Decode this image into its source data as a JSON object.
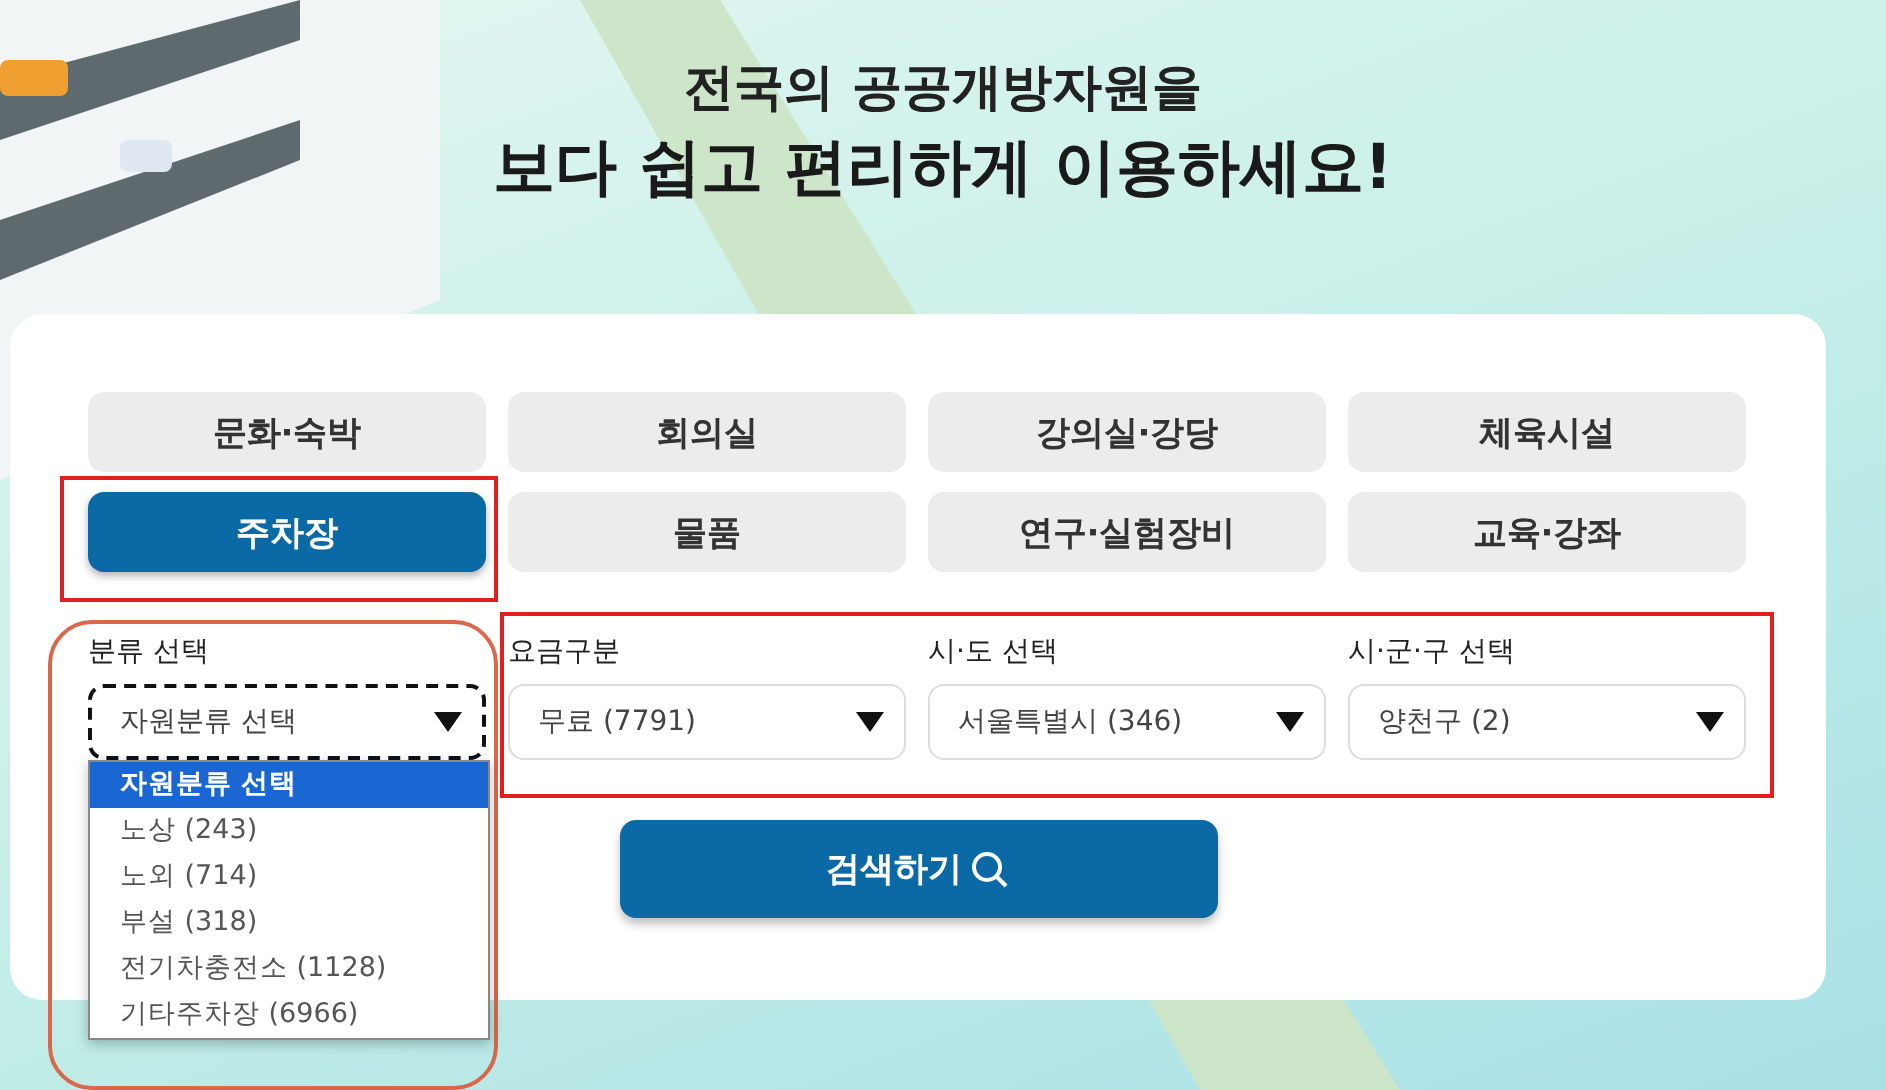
{
  "headline": {
    "line_1": "전국의 공공개방자원을",
    "line_2": "보다 쉽고 편리하게 이용하세요!"
  },
  "tabs": [
    {
      "label": "문화·숙박",
      "selected": false
    },
    {
      "label": "회의실",
      "selected": false
    },
    {
      "label": "강의실·강당",
      "selected": false
    },
    {
      "label": "체육시설",
      "selected": false
    },
    {
      "label": "주차장",
      "selected": true
    },
    {
      "label": "물품",
      "selected": false
    },
    {
      "label": "연구·실험장비",
      "selected": false
    },
    {
      "label": "교육·강좌",
      "selected": false
    }
  ],
  "filters": [
    {
      "label": "분류 선택",
      "value": "자원분류 선택",
      "expanded": true,
      "options": [
        {
          "label": "자원분류 선택",
          "selected": true
        },
        {
          "label": "노상 (243)",
          "selected": false
        },
        {
          "label": "노외 (714)",
          "selected": false
        },
        {
          "label": "부설 (318)",
          "selected": false
        },
        {
          "label": "전기차충전소 (1128)",
          "selected": false
        },
        {
          "label": "기타주차장 (6966)",
          "selected": false
        }
      ]
    },
    {
      "label": "요금구분",
      "value": "무료 (7791)",
      "expanded": false
    },
    {
      "label": "시·도 선택",
      "value": "서울특별시 (346)",
      "expanded": false
    },
    {
      "label": "시·군·구 선택",
      "value": "양천구 (2)",
      "expanded": false
    }
  ],
  "search_button": {
    "label": "검색하기"
  }
}
